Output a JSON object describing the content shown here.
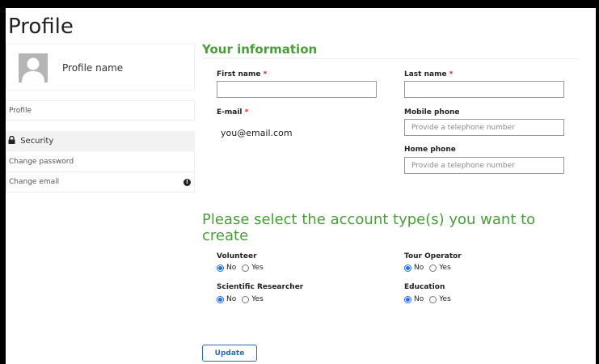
{
  "page": {
    "title": "Profile"
  },
  "sidebar": {
    "profile_name": "Profile name",
    "items": [
      {
        "label": "Profile"
      },
      {
        "label": "Security"
      },
      {
        "label": "Change password"
      },
      {
        "label": "Change email"
      }
    ],
    "icons": {
      "avatar": "user-silhouette-icon",
      "security": "lock-icon",
      "change_email": "exclamation-circle-icon"
    }
  },
  "info": {
    "title": "Your information",
    "first_name": {
      "label": "First name",
      "value": ""
    },
    "last_name": {
      "label": "Last name",
      "value": ""
    },
    "email": {
      "label": "E-mail",
      "value": "you@email.com"
    },
    "mobile_phone": {
      "label": "Mobile phone",
      "placeholder": "Provide a telephone number"
    },
    "home_phone": {
      "label": "Home phone",
      "placeholder": "Provide a telephone number"
    },
    "required_marker": "*"
  },
  "account_types": {
    "title": "Please select the account type(s) you want to create",
    "no_label": "No",
    "yes_label": "Yes",
    "items": [
      {
        "label": "Volunteer",
        "selected": "No"
      },
      {
        "label": "Tour Operator",
        "selected": "No"
      },
      {
        "label": "Scientific Researcher",
        "selected": "No"
      },
      {
        "label": "Education",
        "selected": "No"
      }
    ]
  },
  "actions": {
    "update_label": "Update"
  },
  "colors": {
    "accent_green": "#4a9d3a",
    "button_blue": "#2b6cb0",
    "radio_blue": "#1a73e8",
    "required_red": "#e02020"
  }
}
